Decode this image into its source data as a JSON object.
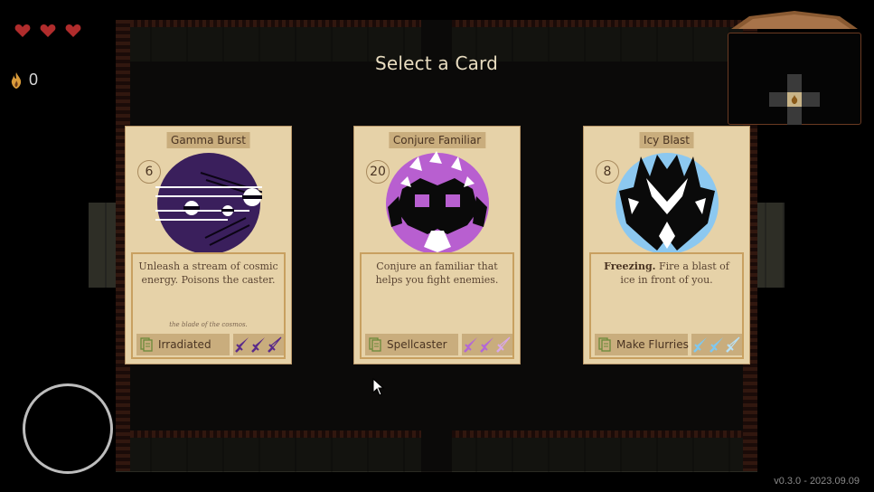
{
  "hud": {
    "hearts": 3,
    "currency_icon": "soul-flame-icon",
    "currency_value": "0",
    "version": "v0.3.0 - 2023.09.09"
  },
  "screen": {
    "title": "Select a Card"
  },
  "cards": [
    {
      "name": "Gamma Burst",
      "cost": "6",
      "art_icon": "gamma-burst-icon",
      "description": "Unleash a stream of cosmic energy. Poisons the caster.",
      "flavor": "the blade of the cosmos.",
      "tag": "Irradiated",
      "sword_color": "#5a2a8a",
      "sword_slots": 3,
      "sword_filled": 3
    },
    {
      "name": "Conjure Familiar",
      "cost": "20",
      "art_icon": "familiar-mask-icon",
      "description": "Conjure an familiar that helps you fight enemies.",
      "flavor": "",
      "tag": "Spellcaster",
      "sword_color": "#b266d8",
      "sword_slots": 3,
      "sword_filled": 2
    },
    {
      "name": "Icy Blast",
      "cost": "8",
      "art_icon": "ice-crystal-icon",
      "description_bold": "Freezing.",
      "description": " Fire a blast of ice in front of you.",
      "flavor": "",
      "tag": "Make Flurries",
      "sword_color": "#7ec8f0",
      "sword_slots": 3,
      "sword_filled": 2
    }
  ]
}
